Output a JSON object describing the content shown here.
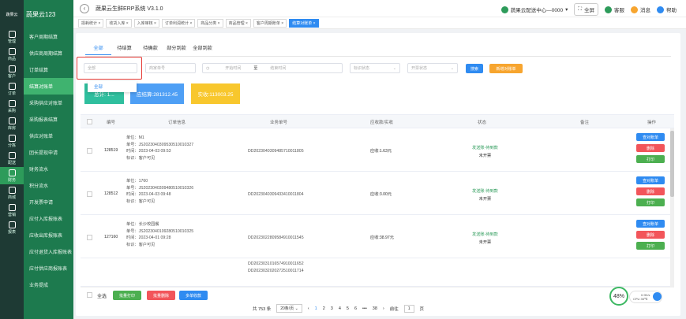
{
  "app": {
    "brand": "蔬果云123",
    "system_title": "蔬果云生鲜ERP系统  V3.1.0",
    "center": "蔬果云配送中心—0000",
    "fullscreen": "全屏",
    "service": "客服",
    "messages": "消息",
    "help": "帮助"
  },
  "rail": [
    {
      "label": "管理",
      "active": false
    },
    {
      "label": "商品",
      "active": false
    },
    {
      "label": "客户",
      "active": false
    },
    {
      "label": "订单",
      "active": false
    },
    {
      "label": "采购",
      "active": false
    },
    {
      "label": "库房",
      "active": false
    },
    {
      "label": "分拣",
      "active": false
    },
    {
      "label": "配送",
      "active": false
    },
    {
      "label": "财务",
      "active": true
    },
    {
      "label": "商城",
      "active": false
    },
    {
      "label": "营销",
      "active": false
    },
    {
      "label": "报表",
      "active": false
    }
  ],
  "sidebar": [
    {
      "label": "客户周期结算",
      "active": false
    },
    {
      "label": "供应商周期结算",
      "active": false
    },
    {
      "label": "订单结算",
      "active": false
    },
    {
      "label": "结算对账单",
      "active": true
    },
    {
      "label": "采购供应对账单",
      "active": false
    },
    {
      "label": "采购报表结算",
      "active": false
    },
    {
      "label": "供应对账单",
      "active": false
    },
    {
      "label": "团长提现申请",
      "active": false
    },
    {
      "label": "财务流水",
      "active": false
    },
    {
      "label": "积分流水",
      "active": false
    },
    {
      "label": "开发票申请",
      "active": false
    },
    {
      "label": "应付入库报账表",
      "active": false
    },
    {
      "label": "应收出库报账表",
      "active": false
    },
    {
      "label": "应付退货入库报账表",
      "active": false
    },
    {
      "label": "应付供应商报账表",
      "active": false
    },
    {
      "label": "业务提成",
      "active": false
    }
  ],
  "tags": [
    {
      "label": "损耗统计 ×",
      "active": false
    },
    {
      "label": "收货入库 ×",
      "active": false
    },
    {
      "label": "入库审核 ×",
      "active": false
    },
    {
      "label": "订单利润统计 ×",
      "active": false
    },
    {
      "label": "商品分类 ×",
      "active": false
    },
    {
      "label": "商品管理 ×",
      "active": false
    },
    {
      "label": "客户周期账单 ×",
      "active": false
    },
    {
      "label": "结算对账单 ×",
      "active": true
    }
  ],
  "tabs": [
    {
      "label": "全部",
      "active": true
    },
    {
      "label": "待结算",
      "active": false
    },
    {
      "label": "待确款",
      "active": false
    },
    {
      "label": "部分到款",
      "active": false
    },
    {
      "label": "全部到款",
      "active": false
    }
  ],
  "filters": {
    "status_value": "全部",
    "order_no_placeholder": "商家单号",
    "start_placeholder": "开始时间",
    "range_sep": "至",
    "end_placeholder": "结束时间",
    "tag_placeholder": "标识状态",
    "settle_placeholder": "开票状态",
    "search": "搜索",
    "create": "新增对账单",
    "dropdown_option": "全部"
  },
  "summary": {
    "total": "总计: 1...",
    "pending": "应结算:281312.45",
    "received": "实收:113003.25"
  },
  "columns": [
    "编号",
    "订单信息",
    "业务单号",
    "应收款/实收",
    "状态",
    "备注",
    "操作"
  ],
  "rows": [
    {
      "id": "128519",
      "unit": "单位：M1",
      "single": "单号：JS2023040309530510010327",
      "time": "时间：2023-04-03 09:53",
      "mark": "标识：客户可见",
      "biz": [
        "DD2023040309485710011805"
      ],
      "amount": "应收:1.63元",
      "status1": "发送账-待到款",
      "status2": "未开票"
    },
    {
      "id": "128512",
      "unit": "单位：1760",
      "single": "单号：JS2023040309480510010326",
      "time": "时间：2023-04-03 09:48",
      "mark": "标识：客户可见",
      "biz": [
        "DD2023040309433410011804"
      ],
      "amount": "应收:3.00元",
      "status1": "发送账-待到款",
      "status2": "未开票"
    },
    {
      "id": "127160",
      "unit": "单位：长沙校园餐",
      "single": "单号：JS2023040109280510010325",
      "time": "时间：2023-04-01 09:28",
      "mark": "标识：客户可见",
      "biz": [
        "DD2023022809584910011545"
      ],
      "amount": "应收:38.97元",
      "status1": "发送账-待到款",
      "status2": "未开票"
    },
    {
      "id": "",
      "unit": "",
      "single": "",
      "time": "",
      "mark": "",
      "biz": [
        "DD2023031016574910011652",
        "DD2023032020272510011714"
      ],
      "amount": "",
      "status1": "",
      "status2": ""
    }
  ],
  "ops": {
    "print_bill": "查对账单",
    "delete": "删除",
    "print": "打印"
  },
  "footer": {
    "select_all": "全选",
    "batch_print": "批量打印",
    "batch_delete": "批量删除",
    "multi_receive": "多单收款",
    "total_text": "共 753 条",
    "per_page": "20条/页",
    "pages": [
      "1",
      "2",
      "3",
      "4",
      "5",
      "6",
      "•••",
      "38"
    ],
    "goto_label": "前往",
    "goto_value": "1",
    "page_suffix": "页"
  },
  "cpu": {
    "percent": "48%",
    "speed": "0.9K/s",
    "temp": "CPU 35℃"
  },
  "colors": {
    "primary": "#2f8bf1",
    "green": "#2d9b5a",
    "orange": "#f7a52f",
    "red": "#f2555a",
    "teal": "#2fbf9e"
  }
}
